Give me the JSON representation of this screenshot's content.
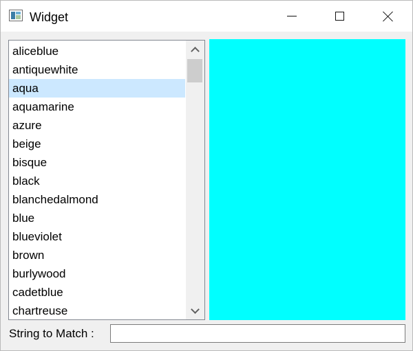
{
  "window": {
    "title": "Widget",
    "icon": "app-window-icon",
    "controls": [
      "minimize-icon",
      "maximize-icon",
      "close-icon"
    ]
  },
  "color_list": {
    "items": [
      "aliceblue",
      "antiquewhite",
      "aqua",
      "aquamarine",
      "azure",
      "beige",
      "bisque",
      "black",
      "blanchedalmond",
      "blue",
      "blueviolet",
      "brown",
      "burlywood",
      "cadetblue",
      "chartreuse"
    ],
    "selected": "aqua",
    "selected_color": "#cce8ff",
    "scroll_position": 0.02
  },
  "preview": {
    "color": "#00ffff"
  },
  "filter": {
    "label": "String to Match :",
    "value": "",
    "placeholder": ""
  }
}
